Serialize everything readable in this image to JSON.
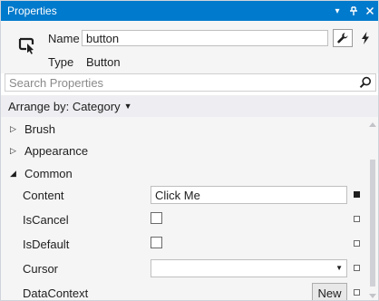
{
  "window": {
    "title": "Properties",
    "controls": {
      "dropdown": "▾",
      "pin": "⊥",
      "close": "×"
    }
  },
  "header": {
    "element_icon": "cursor-select-icon",
    "name_label": "Name",
    "name_value": "button",
    "type_label": "Type",
    "type_value": "Button",
    "tools": [
      "wrench-icon",
      "lightning-icon"
    ]
  },
  "search": {
    "placeholder": "Search Properties",
    "icon": "search-icon"
  },
  "arrange": {
    "label": "Arrange by: Category",
    "caret": "▼"
  },
  "categories": [
    {
      "label": "Brush",
      "expanded": false,
      "glyph": "▷"
    },
    {
      "label": "Appearance",
      "expanded": false,
      "glyph": "▷"
    },
    {
      "label": "Common",
      "expanded": true,
      "glyph": "◢"
    }
  ],
  "properties": [
    {
      "name": "Content",
      "editor": "text",
      "value": "Click Me",
      "marker": "set"
    },
    {
      "name": "IsCancel",
      "editor": "checkbox",
      "checked": false,
      "marker": "unset"
    },
    {
      "name": "IsDefault",
      "editor": "checkbox",
      "checked": false,
      "marker": "unset"
    },
    {
      "name": "Cursor",
      "editor": "select",
      "value": "",
      "marker": "unset"
    },
    {
      "name": "DataContext",
      "editor": "button",
      "button_label": "New",
      "marker": "unset"
    }
  ],
  "colors": {
    "titlebar": "#007acc",
    "panel_bg": "#f5f5f5",
    "arrange_bg": "#eeeef2",
    "text": "#1e1e1e"
  }
}
